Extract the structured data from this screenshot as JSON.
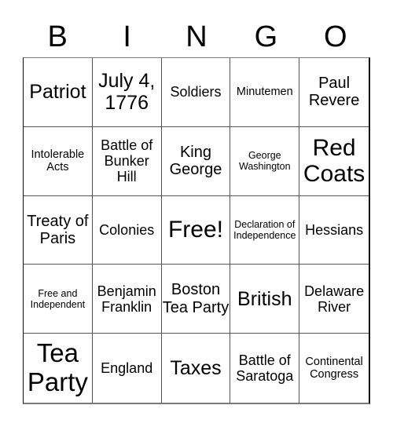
{
  "header": {
    "letters": [
      "B",
      "I",
      "N",
      "G",
      "O"
    ]
  },
  "card": {
    "rows": [
      [
        {
          "text": "Patriot",
          "size": "xl"
        },
        {
          "text": "July 4, 1776",
          "size": "xl"
        },
        {
          "text": "Soldiers",
          "size": "m"
        },
        {
          "text": "Minutemen",
          "size": "s"
        },
        {
          "text": "Paul Revere",
          "size": "l"
        }
      ],
      [
        {
          "text": "Intolerable Acts",
          "size": "s"
        },
        {
          "text": "Battle of Bunker Hill",
          "size": "m"
        },
        {
          "text": "King George",
          "size": "l"
        },
        {
          "text": "George Washington",
          "size": "xs"
        },
        {
          "text": "Red Coats",
          "size": "xxl"
        }
      ],
      [
        {
          "text": "Treaty of Paris",
          "size": "l"
        },
        {
          "text": "Colonies",
          "size": "m"
        },
        {
          "text": "Free!",
          "size": "xxl"
        },
        {
          "text": "Declaration of Independence",
          "size": "xs"
        },
        {
          "text": "Hessians",
          "size": "m"
        }
      ],
      [
        {
          "text": "Free and Independent",
          "size": "xs"
        },
        {
          "text": "Benjamin Franklin",
          "size": "m"
        },
        {
          "text": "Boston Tea Party",
          "size": "l"
        },
        {
          "text": "British",
          "size": "xl"
        },
        {
          "text": "Delaware River",
          "size": "m"
        }
      ],
      [
        {
          "text": "Tea Party",
          "size": "xxxl"
        },
        {
          "text": "England",
          "size": "m"
        },
        {
          "text": "Taxes",
          "size": "xl"
        },
        {
          "text": "Battle of Saratoga",
          "size": "m"
        },
        {
          "text": "Continental Congress",
          "size": "s"
        }
      ]
    ]
  }
}
